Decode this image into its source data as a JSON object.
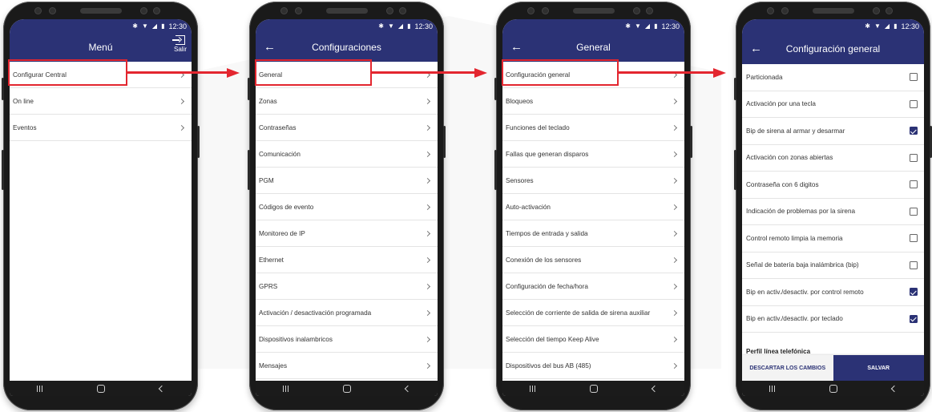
{
  "status_bar": {
    "time": "12:30",
    "icons": [
      "bluetooth-icon",
      "wifi-icon",
      "signal-icon",
      "battery-icon"
    ]
  },
  "screen1": {
    "title": "Menú",
    "exit_label": "Salir",
    "items": [
      {
        "label": "Configurar Central"
      },
      {
        "label": "On line"
      },
      {
        "label": "Eventos"
      }
    ]
  },
  "screen2": {
    "title": "Configuraciones",
    "items": [
      {
        "label": "General"
      },
      {
        "label": "Zonas"
      },
      {
        "label": "Contraseñas"
      },
      {
        "label": "Comunicación"
      },
      {
        "label": "PGM"
      },
      {
        "label": "Códigos de evento"
      },
      {
        "label": "Monitoreo de IP"
      },
      {
        "label": "Ethernet"
      },
      {
        "label": "GPRS"
      },
      {
        "label": "Activación / desactivación programada"
      },
      {
        "label": "Dispositivos inalambricos"
      },
      {
        "label": "Mensajes"
      }
    ]
  },
  "screen3": {
    "title": "General",
    "items": [
      {
        "label": "Configuración general"
      },
      {
        "label": "Bloqueos"
      },
      {
        "label": "Funciones del teclado"
      },
      {
        "label": "Fallas que generan disparos"
      },
      {
        "label": "Sensores"
      },
      {
        "label": "Auto-activación"
      },
      {
        "label": "Tiempos de entrada y salida"
      },
      {
        "label": "Conexión de los sensores"
      },
      {
        "label": "Configuración de fecha/hora"
      },
      {
        "label": "Selección de corriente de salida de sirena auxiliar"
      },
      {
        "label": "Selección del tiempo Keep Alive"
      },
      {
        "label": "Dispositivos del bus AB (485)"
      }
    ]
  },
  "screen4": {
    "title": "Configuración general",
    "options": [
      {
        "label": "Particionada",
        "checked": false
      },
      {
        "label": "Activación por una tecla",
        "checked": false
      },
      {
        "label": "Bip de sirena al armar y desarmar",
        "checked": true
      },
      {
        "label": "Activación con zonas abiertas",
        "checked": false
      },
      {
        "label": "Contraseña con 6 digitos",
        "checked": false
      },
      {
        "label": "Indicación de problemas por la sirena",
        "checked": false
      },
      {
        "label": "Control remoto limpia la memoria",
        "checked": false
      },
      {
        "label": "Señal de batería baja inalámbrica (bip)",
        "checked": false
      },
      {
        "label": "Bip en activ./desactiv. por control remoto",
        "checked": true
      },
      {
        "label": "Bip en activ./desactiv. por teclado",
        "checked": true
      }
    ],
    "section_header": "Perfil línea telefónica",
    "discard_label": "DESCARTAR LOS CAMBIOS",
    "save_label": "SALVAR"
  },
  "colors": {
    "primary": "#2b3275",
    "highlight": "#e3262f"
  }
}
